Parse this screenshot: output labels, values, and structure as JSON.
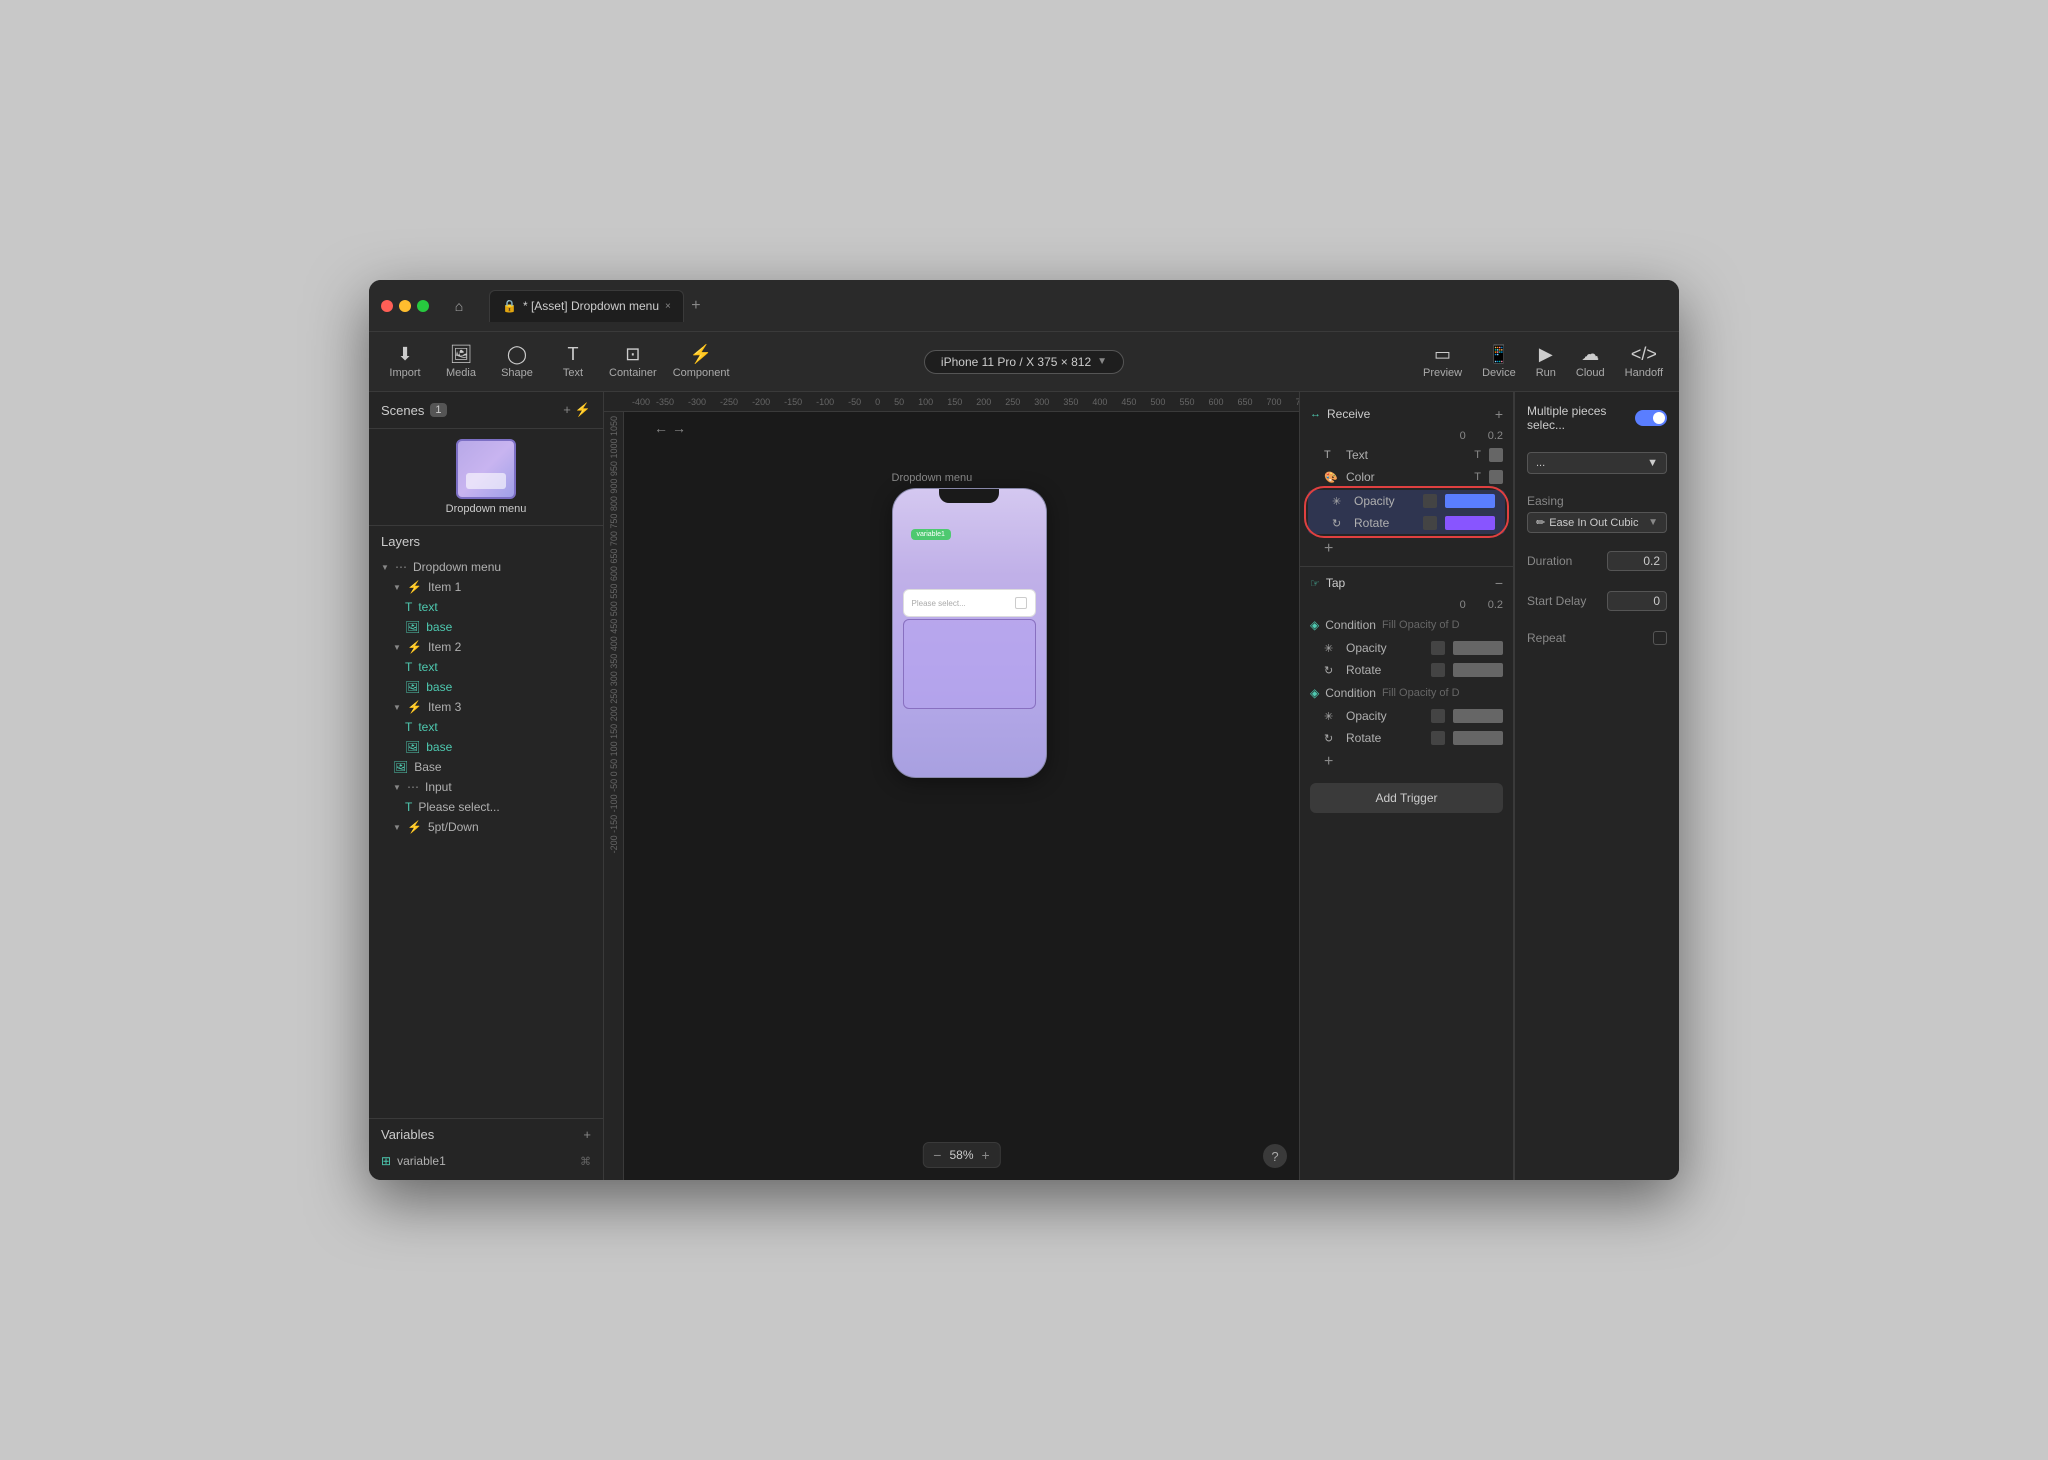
{
  "window": {
    "title": "* [Asset] Dropdown menu",
    "tab_close": "×",
    "tab_add": "+"
  },
  "toolbar": {
    "import": "Import",
    "media": "Media",
    "shape": "Shape",
    "text": "Text",
    "container": "Container",
    "component": "Component",
    "device_label": "iPhone 11 Pro / X  375 × 812",
    "preview": "Preview",
    "device": "Device",
    "run": "Run",
    "cloud": "Cloud",
    "handoff": "Handoff"
  },
  "sidebar": {
    "scenes_label": "Scenes",
    "scenes_count": "1",
    "scene_name": "Dropdown menu",
    "layers_label": "Layers",
    "layers": [
      {
        "id": "dropdown-menu",
        "name": "Dropdown menu",
        "indent": 1,
        "icon": "frame",
        "expand": true
      },
      {
        "id": "item1",
        "name": "Item 1",
        "indent": 2,
        "icon": "lightning",
        "expand": true
      },
      {
        "id": "item1-text",
        "name": "text",
        "indent": 3,
        "icon": "text"
      },
      {
        "id": "item1-base",
        "name": "base",
        "indent": 3,
        "icon": "img"
      },
      {
        "id": "item2",
        "name": "Item 2",
        "indent": 2,
        "icon": "lightning",
        "expand": true
      },
      {
        "id": "item2-text",
        "name": "text",
        "indent": 3,
        "icon": "text"
      },
      {
        "id": "item2-base",
        "name": "base",
        "indent": 3,
        "icon": "img"
      },
      {
        "id": "item3",
        "name": "Item 3",
        "indent": 2,
        "icon": "lightning",
        "expand": true
      },
      {
        "id": "item3-text",
        "name": "text",
        "indent": 3,
        "icon": "text"
      },
      {
        "id": "item3-base",
        "name": "base",
        "indent": 3,
        "icon": "img"
      },
      {
        "id": "base",
        "name": "Base",
        "indent": 2,
        "icon": "img"
      },
      {
        "id": "input",
        "name": "Input",
        "indent": 2,
        "icon": "frame",
        "expand": true
      },
      {
        "id": "please-select",
        "name": "Please select...",
        "indent": 3,
        "icon": "text"
      },
      {
        "id": "5pt-down",
        "name": "5pt/Down",
        "indent": 2,
        "icon": "frame",
        "expand": true
      }
    ],
    "variables_label": "Variables",
    "variables": [
      {
        "name": "variable1"
      }
    ]
  },
  "canvas": {
    "phone_label": "Dropdown menu",
    "variable_badge": "variable1",
    "select_placeholder": "Please select...",
    "zoom": "58%"
  },
  "right_panel": {
    "receive_label": "Receive",
    "tap_label": "Tap",
    "add_trigger": "Add Trigger",
    "receive_items": [
      {
        "icon": "T",
        "name": "Text",
        "has_t": true
      },
      {
        "icon": "color",
        "name": "Color",
        "has_t": true
      },
      {
        "icon": "opacity",
        "name": "Opacity",
        "square": true,
        "color": "blue",
        "highlighted": true
      },
      {
        "icon": "rotate",
        "name": "Rotate",
        "square": true,
        "color": "purple",
        "highlighted": true
      }
    ],
    "receive_values": "0    0.2",
    "tap_values": "0    0.2",
    "tap_sections": [
      {
        "type": "condition",
        "label": "Condition",
        "fill_label": "Fill Opacity of D",
        "items": [
          {
            "name": "Opacity",
            "square": true,
            "color": "gray"
          },
          {
            "name": "Rotate",
            "square": true,
            "color": "gray"
          }
        ]
      },
      {
        "type": "condition",
        "label": "Condition",
        "fill_label": "Fill Opacity of D",
        "items": [
          {
            "name": "Opacity",
            "square": true,
            "color": "gray"
          },
          {
            "name": "Rotate",
            "square": true,
            "color": "gray"
          }
        ]
      }
    ],
    "properties": {
      "multiple_select_label": "Multiple pieces selec...",
      "toggle_on": true,
      "easing_label": "Easing",
      "easing_value": "Ease In Out Cubic",
      "duration_label": "Duration",
      "duration_value": "0.2",
      "start_delay_label": "Start Delay",
      "start_delay_value": "0",
      "repeat_label": "Repeat"
    }
  }
}
